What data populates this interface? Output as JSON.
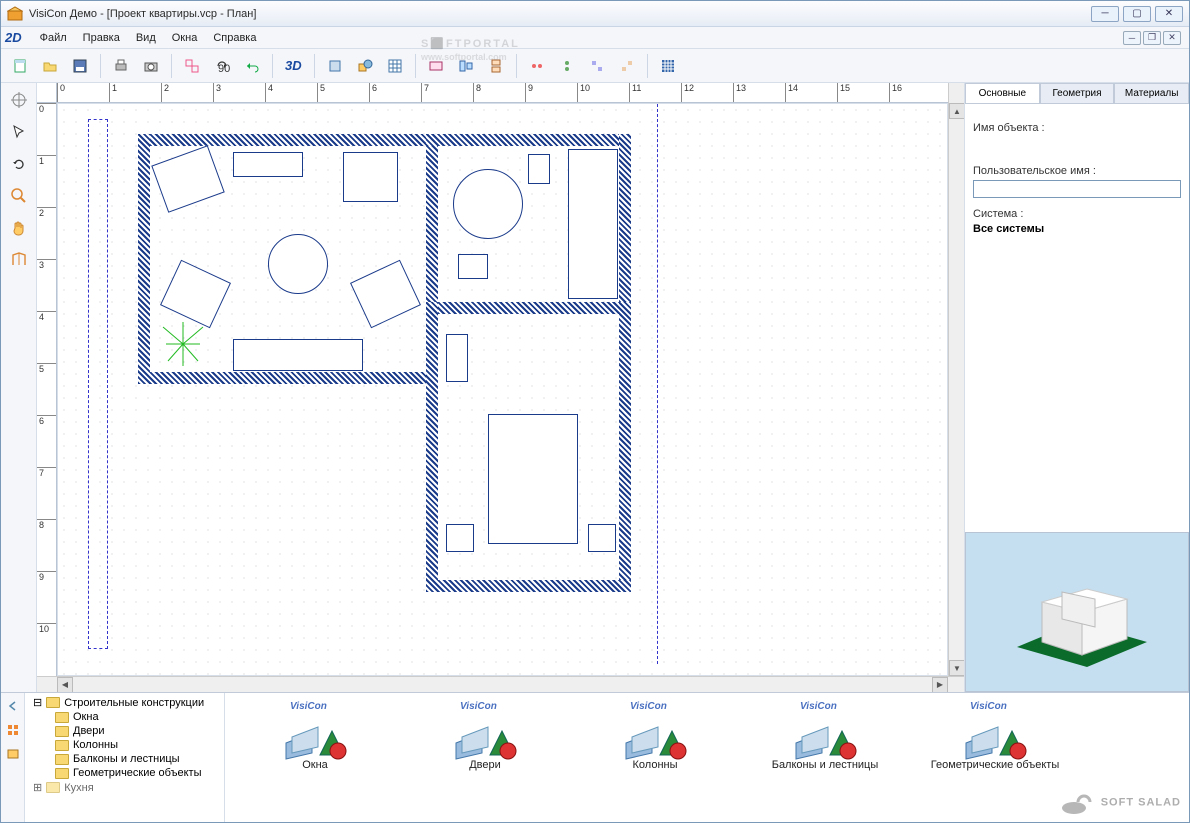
{
  "window": {
    "title": "VisiCon Демо - [Проект квартиры.vcp - План]"
  },
  "menubar": {
    "mode": "2D",
    "items": [
      "Файл",
      "Правка",
      "Вид",
      "Окна",
      "Справка"
    ]
  },
  "toolbar": {
    "btn_3d": "3D",
    "icons": [
      "new-file",
      "open-file",
      "save",
      "print",
      "camera",
      "group",
      "rotate-90",
      "undo",
      "sep",
      "3d",
      "sep",
      "window-tool",
      "shapes-tool",
      "grid-tool",
      "layers",
      "align-left",
      "align-center",
      "align-right",
      "distribute-h",
      "distribute-v",
      "snap-grid"
    ]
  },
  "left_tools": [
    "pan-origin",
    "pointer",
    "rotate",
    "zoom",
    "hand",
    "walls"
  ],
  "ruler": {
    "h_ticks": [
      0,
      1,
      2,
      3,
      4,
      5,
      6,
      7,
      8,
      9,
      10,
      11,
      12,
      13,
      14,
      15,
      16
    ],
    "v_ticks": [
      0,
      1,
      2,
      3,
      4,
      5,
      6,
      7,
      8,
      9,
      10
    ]
  },
  "right_panel": {
    "tabs": [
      "Основные",
      "Геометрия",
      "Материалы"
    ],
    "active_tab": 0,
    "label_object_name": "Имя объекта :",
    "object_name": "",
    "label_user_name": "Пользовательское имя :",
    "user_name": "",
    "label_system": "Система :",
    "system_value": "Все системы"
  },
  "bottom_panel": {
    "tree": {
      "root": "Строительные конструкции",
      "children": [
        "Окна",
        "Двери",
        "Колонны",
        "Балконы и лестницы",
        "Геометрические объекты"
      ],
      "overflow": "Кухня"
    },
    "catalog": [
      {
        "brand": "VisiCon",
        "label": "Окна"
      },
      {
        "brand": "VisiCon",
        "label": "Двери"
      },
      {
        "brand": "VisiCon",
        "label": "Колонны"
      },
      {
        "brand": "VisiCon",
        "label": "Балконы и лестницы"
      },
      {
        "brand": "VisiCon",
        "label": "Геометрические объекты"
      }
    ]
  },
  "watermark": {
    "title": "S⬛FTPORTAL",
    "sub": "www.softportal.com"
  },
  "watermark2": "SOFT SALAD"
}
